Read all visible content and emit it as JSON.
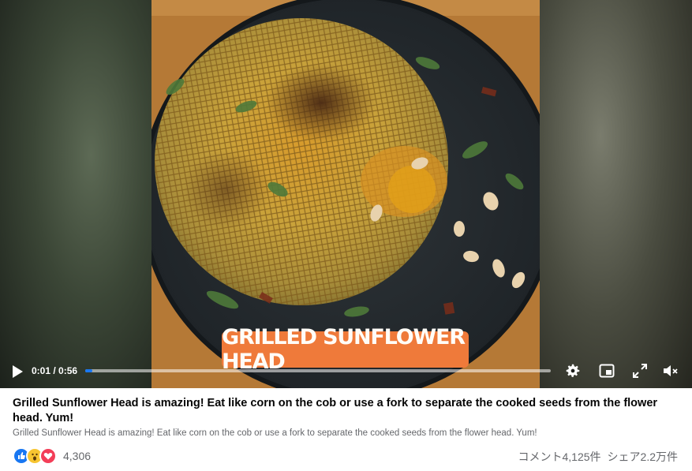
{
  "video": {
    "overlay_text": "GRILLED SUNFLOWER HEAD",
    "current_time": "0:01",
    "duration": "0:56",
    "time_display": "0:01 / 0:56",
    "progress": 0.015,
    "accent_color": "#1877f2",
    "icons": [
      "play-icon",
      "settings-gear-icon",
      "picture-in-picture-icon",
      "fullscreen-icon",
      "muted-speaker-icon"
    ]
  },
  "post": {
    "title": "Grilled Sunflower Head is amazing! Eat like corn on the cob or use a fork to separate the cooked seeds from the flower head. Yum!",
    "description": "Grilled Sunflower Head is amazing! Eat like corn on the cob or use a fork to separate the cooked seeds from the flower head. Yum!",
    "reactions": {
      "types": [
        "like",
        "wow",
        "love"
      ],
      "count": "4,306"
    },
    "comments": "コメント4,125件",
    "shares": "シェア2.2万件"
  }
}
